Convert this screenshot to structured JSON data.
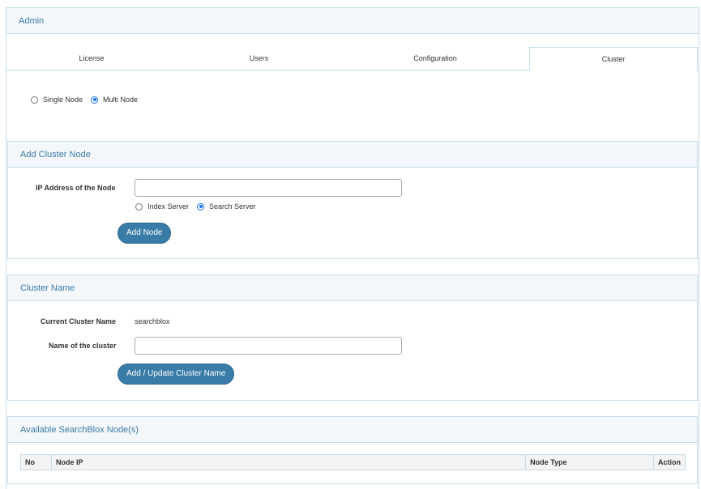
{
  "admin": {
    "title": "Admin"
  },
  "tabs": [
    {
      "label": "License"
    },
    {
      "label": "Users"
    },
    {
      "label": "Configuration"
    },
    {
      "label": "Cluster",
      "active": true
    }
  ],
  "mode": {
    "options": [
      "Single Node",
      "Multi Node"
    ],
    "selected": "Multi Node"
  },
  "add_cluster_node": {
    "title": "Add Cluster Node",
    "ip_label": "IP Address of the Node",
    "ip_value": "",
    "server_options": [
      "Index Server",
      "Search Server"
    ],
    "server_selected": "Search Server",
    "button_label": "Add Node"
  },
  "cluster_name": {
    "title": "Cluster Name",
    "current_label": "Current Cluster Name",
    "current_value": "searchblox",
    "name_label": "Name of the cluster",
    "name_value": "",
    "button_label": "Add / Update Cluster Name"
  },
  "available_nodes": {
    "title": "Available SearchBlox Node(s)",
    "columns": [
      "No",
      "Node IP",
      "Node Type",
      "Action"
    ],
    "rows": []
  },
  "colors": {
    "accent": "#3a7ca8",
    "header_text": "#3c7aa5",
    "border": "#c7dbe8",
    "header_bg": "#f3f7fa"
  }
}
